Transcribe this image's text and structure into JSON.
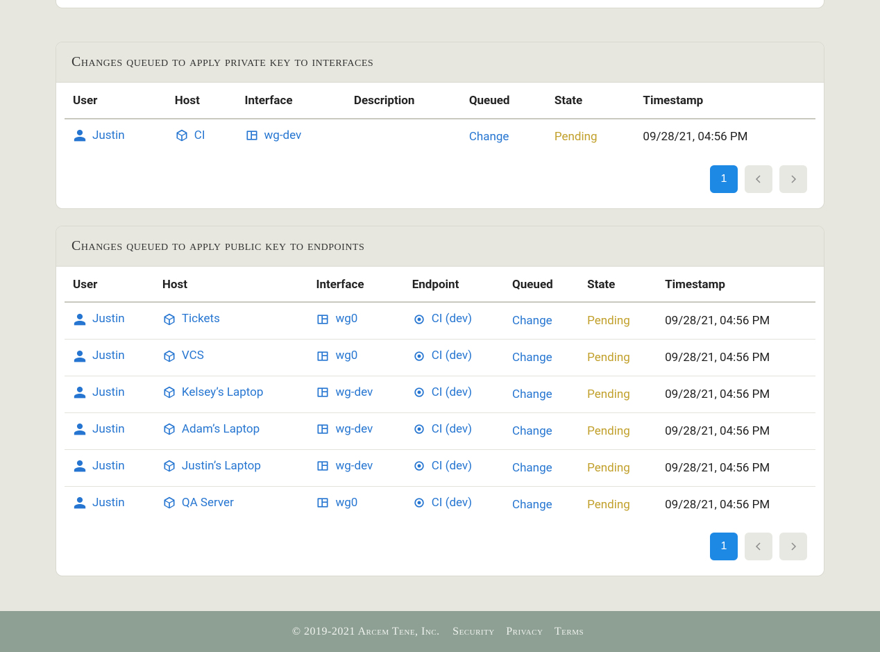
{
  "card0": {},
  "card1": {
    "title": "Changes queued to apply private key to interfaces",
    "columns": [
      "User",
      "Host",
      "Interface",
      "Description",
      "Queued",
      "State",
      "Timestamp"
    ],
    "rows": [
      {
        "user": "Justin",
        "host": "CI",
        "interface": "wg-dev",
        "description": "",
        "queued": "Change",
        "state": "Pending",
        "timestamp": "09/28/21, 04:56 PM"
      }
    ],
    "pager": {
      "page": "1"
    }
  },
  "card2": {
    "title": "Changes queued to apply public key to endpoints",
    "columns": [
      "User",
      "Host",
      "Interface",
      "Endpoint",
      "Queued",
      "State",
      "Timestamp"
    ],
    "rows": [
      {
        "user": "Justin",
        "host": "Tickets",
        "interface": "wg0",
        "endpoint": "CI (dev)",
        "queued": "Change",
        "state": "Pending",
        "timestamp": "09/28/21, 04:56 PM"
      },
      {
        "user": "Justin",
        "host": "VCS",
        "interface": "wg0",
        "endpoint": "CI (dev)",
        "queued": "Change",
        "state": "Pending",
        "timestamp": "09/28/21, 04:56 PM"
      },
      {
        "user": "Justin",
        "host": "Kelsey’s Laptop",
        "interface": "wg-dev",
        "endpoint": "CI (dev)",
        "queued": "Change",
        "state": "Pending",
        "timestamp": "09/28/21, 04:56 PM"
      },
      {
        "user": "Justin",
        "host": "Adam’s Laptop",
        "interface": "wg-dev",
        "endpoint": "CI (dev)",
        "queued": "Change",
        "state": "Pending",
        "timestamp": "09/28/21, 04:56 PM"
      },
      {
        "user": "Justin",
        "host": "Justin’s Laptop",
        "interface": "wg-dev",
        "endpoint": "CI (dev)",
        "queued": "Change",
        "state": "Pending",
        "timestamp": "09/28/21, 04:56 PM"
      },
      {
        "user": "Justin",
        "host": "QA Server",
        "interface": "wg0",
        "endpoint": "CI (dev)",
        "queued": "Change",
        "state": "Pending",
        "timestamp": "09/28/21, 04:56 PM"
      }
    ],
    "pager": {
      "page": "1"
    }
  },
  "footer": {
    "copyright": "© 2019-2021 Arcem Tene, Inc.",
    "links": [
      "Security",
      "Privacy",
      "Terms"
    ]
  }
}
